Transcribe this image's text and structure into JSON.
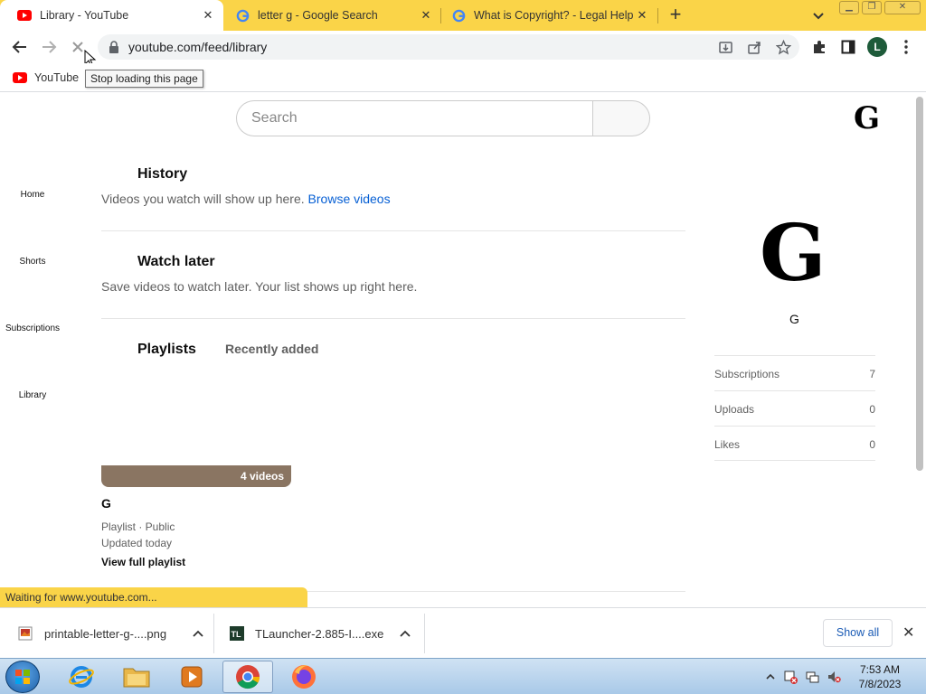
{
  "browser": {
    "tabs": [
      {
        "title": "Library - YouTube",
        "favicon": "youtube-icon",
        "active": true
      },
      {
        "title": "letter g - Google Search",
        "favicon": "google-icon",
        "active": false
      },
      {
        "title": "What is Copyright? - Legal Help",
        "favicon": "google-icon",
        "active": false
      }
    ],
    "url": "youtube.com/feed/library",
    "profile_initial": "L",
    "bookmarks": [
      {
        "label": "YouTube",
        "icon": "youtube-icon"
      }
    ],
    "tooltip": "Stop loading this page",
    "status": "Waiting for www.youtube.com..."
  },
  "youtube": {
    "search_placeholder": "Search",
    "header_avatar": "G",
    "guide": [
      "Home",
      "Shorts",
      "Subscriptions",
      "Library"
    ],
    "history": {
      "title": "History",
      "desc": "Videos you watch will show up here.",
      "link": "Browse videos"
    },
    "watch_later": {
      "title": "Watch later",
      "desc": "Save videos to watch later. Your list shows up right here."
    },
    "playlists": {
      "title": "Playlists",
      "sort": "Recently added",
      "item": {
        "count": "4 videos",
        "title": "G",
        "meta": "Playlist · Public",
        "updated": "Updated today",
        "view_link": "View full playlist"
      }
    },
    "channel": {
      "avatar": "G",
      "name": "G",
      "stats": [
        {
          "label": "Subscriptions",
          "value": "7"
        },
        {
          "label": "Uploads",
          "value": "0"
        },
        {
          "label": "Likes",
          "value": "0"
        }
      ]
    }
  },
  "downloads": {
    "items": [
      {
        "name": "printable-letter-g-....png",
        "icon": "image-file-icon"
      },
      {
        "name": "TLauncher-2.885-I....exe",
        "icon": "tlauncher-icon"
      }
    ],
    "show_all": "Show all"
  },
  "taskbar": {
    "apps": [
      "internet-explorer-icon",
      "file-explorer-icon",
      "media-player-icon",
      "chrome-icon",
      "firefox-icon"
    ],
    "time": "7:53 AM",
    "date": "7/8/2023"
  },
  "colors": {
    "tabstrip": "#fad448",
    "youtube_red": "#ff0000",
    "link_blue": "#065fd4",
    "playlist_thumb": "#8a7562"
  }
}
